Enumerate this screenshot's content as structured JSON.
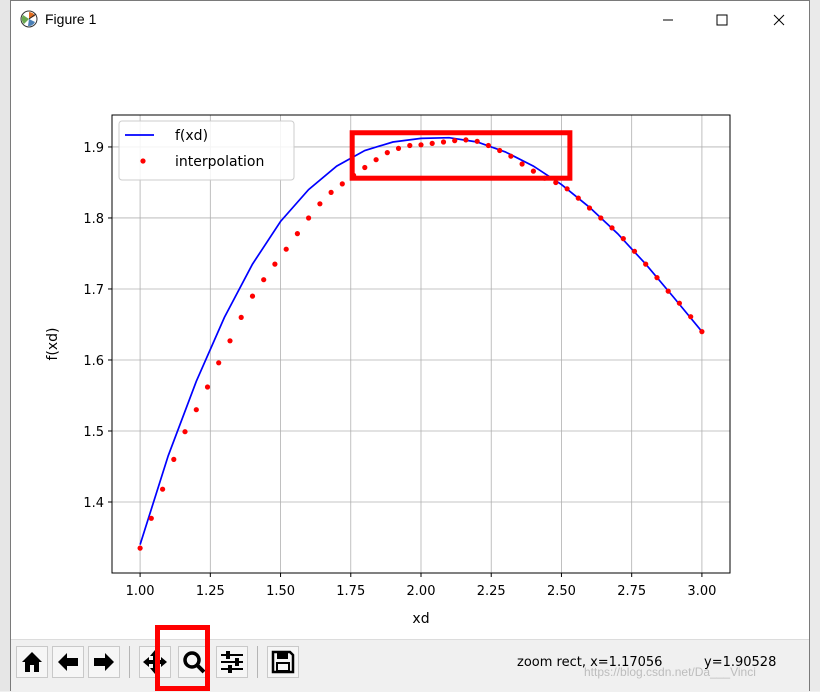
{
  "window": {
    "title": "Figure 1",
    "minimize_icon": "minimize-icon",
    "maximize_icon": "maximize-icon",
    "close_icon": "close-icon"
  },
  "toolbar": {
    "buttons": [
      {
        "name": "home-button",
        "icon": "home-icon"
      },
      {
        "name": "back-button",
        "icon": "arrow-left-icon"
      },
      {
        "name": "forward-button",
        "icon": "arrow-right-icon"
      },
      {
        "name": "pan-button",
        "icon": "move-icon"
      },
      {
        "name": "zoom-button",
        "icon": "magnifier-icon"
      },
      {
        "name": "configure-subplots-button",
        "icon": "sliders-icon"
      },
      {
        "name": "save-button",
        "icon": "floppy-icon"
      }
    ],
    "status_mode": "zoom rect, x=1.17056",
    "status_y": "y=1.90528"
  },
  "watermark": "https://blog.csdn.net/Da___Vinci",
  "chart_data": {
    "type": "line",
    "xlabel": "xd",
    "ylabel": "f(xd)",
    "xlim": [
      0.9,
      3.1
    ],
    "ylim": [
      1.3,
      1.945
    ],
    "xticks": [
      "1.00",
      "1.25",
      "1.50",
      "1.75",
      "2.00",
      "2.25",
      "2.50",
      "2.75",
      "3.00"
    ],
    "yticks": [
      "1.4",
      "1.5",
      "1.6",
      "1.7",
      "1.8",
      "1.9"
    ],
    "grid": true,
    "legend_position": "top-left",
    "legend": [
      "f(xd)",
      "interpolation"
    ],
    "series": [
      {
        "name": "f(xd)",
        "kind": "line",
        "color": "#0000ff",
        "x": [
          1.0,
          1.1,
          1.2,
          1.3,
          1.4,
          1.5,
          1.6,
          1.7,
          1.8,
          1.9,
          2.0,
          2.1,
          2.2,
          2.3,
          2.4,
          2.5,
          2.6,
          2.7,
          2.8,
          2.9,
          3.0
        ],
        "y": [
          1.34,
          1.465,
          1.57,
          1.66,
          1.735,
          1.795,
          1.84,
          1.873,
          1.895,
          1.907,
          1.912,
          1.913,
          1.907,
          1.893,
          1.873,
          1.847,
          1.815,
          1.778,
          1.735,
          1.688,
          1.64
        ]
      },
      {
        "name": "interpolation",
        "kind": "scatter",
        "color": "#ff0000",
        "x": [
          1.0,
          1.04,
          1.08,
          1.12,
          1.16,
          1.2,
          1.24,
          1.28,
          1.32,
          1.36,
          1.4,
          1.44,
          1.48,
          1.52,
          1.56,
          1.6,
          1.64,
          1.68,
          1.72,
          1.76,
          1.8,
          1.84,
          1.88,
          1.92,
          1.96,
          2.0,
          2.04,
          2.08,
          2.12,
          2.16,
          2.2,
          2.24,
          2.28,
          2.32,
          2.36,
          2.4,
          2.44,
          2.48,
          2.52,
          2.56,
          2.6,
          2.64,
          2.68,
          2.72,
          2.76,
          2.8,
          2.84,
          2.88,
          2.92,
          2.96,
          3.0
        ],
        "y": [
          1.335,
          1.377,
          1.418,
          1.46,
          1.499,
          1.53,
          1.562,
          1.596,
          1.627,
          1.66,
          1.69,
          1.713,
          1.735,
          1.756,
          1.778,
          1.8,
          1.82,
          1.836,
          1.848,
          1.86,
          1.871,
          1.882,
          1.892,
          1.898,
          1.902,
          1.903,
          1.905,
          1.907,
          1.909,
          1.91,
          1.908,
          1.902,
          1.895,
          1.887,
          1.876,
          1.866,
          1.856,
          1.85,
          1.841,
          1.828,
          1.814,
          1.8,
          1.786,
          1.771,
          1.753,
          1.735,
          1.716,
          1.697,
          1.68,
          1.661,
          1.64
        ]
      }
    ],
    "annotation_box_color": "#ff0000",
    "annotation_box": {
      "x0": 1.755,
      "x1": 2.53,
      "y0": 1.856,
      "y1": 1.92
    }
  }
}
